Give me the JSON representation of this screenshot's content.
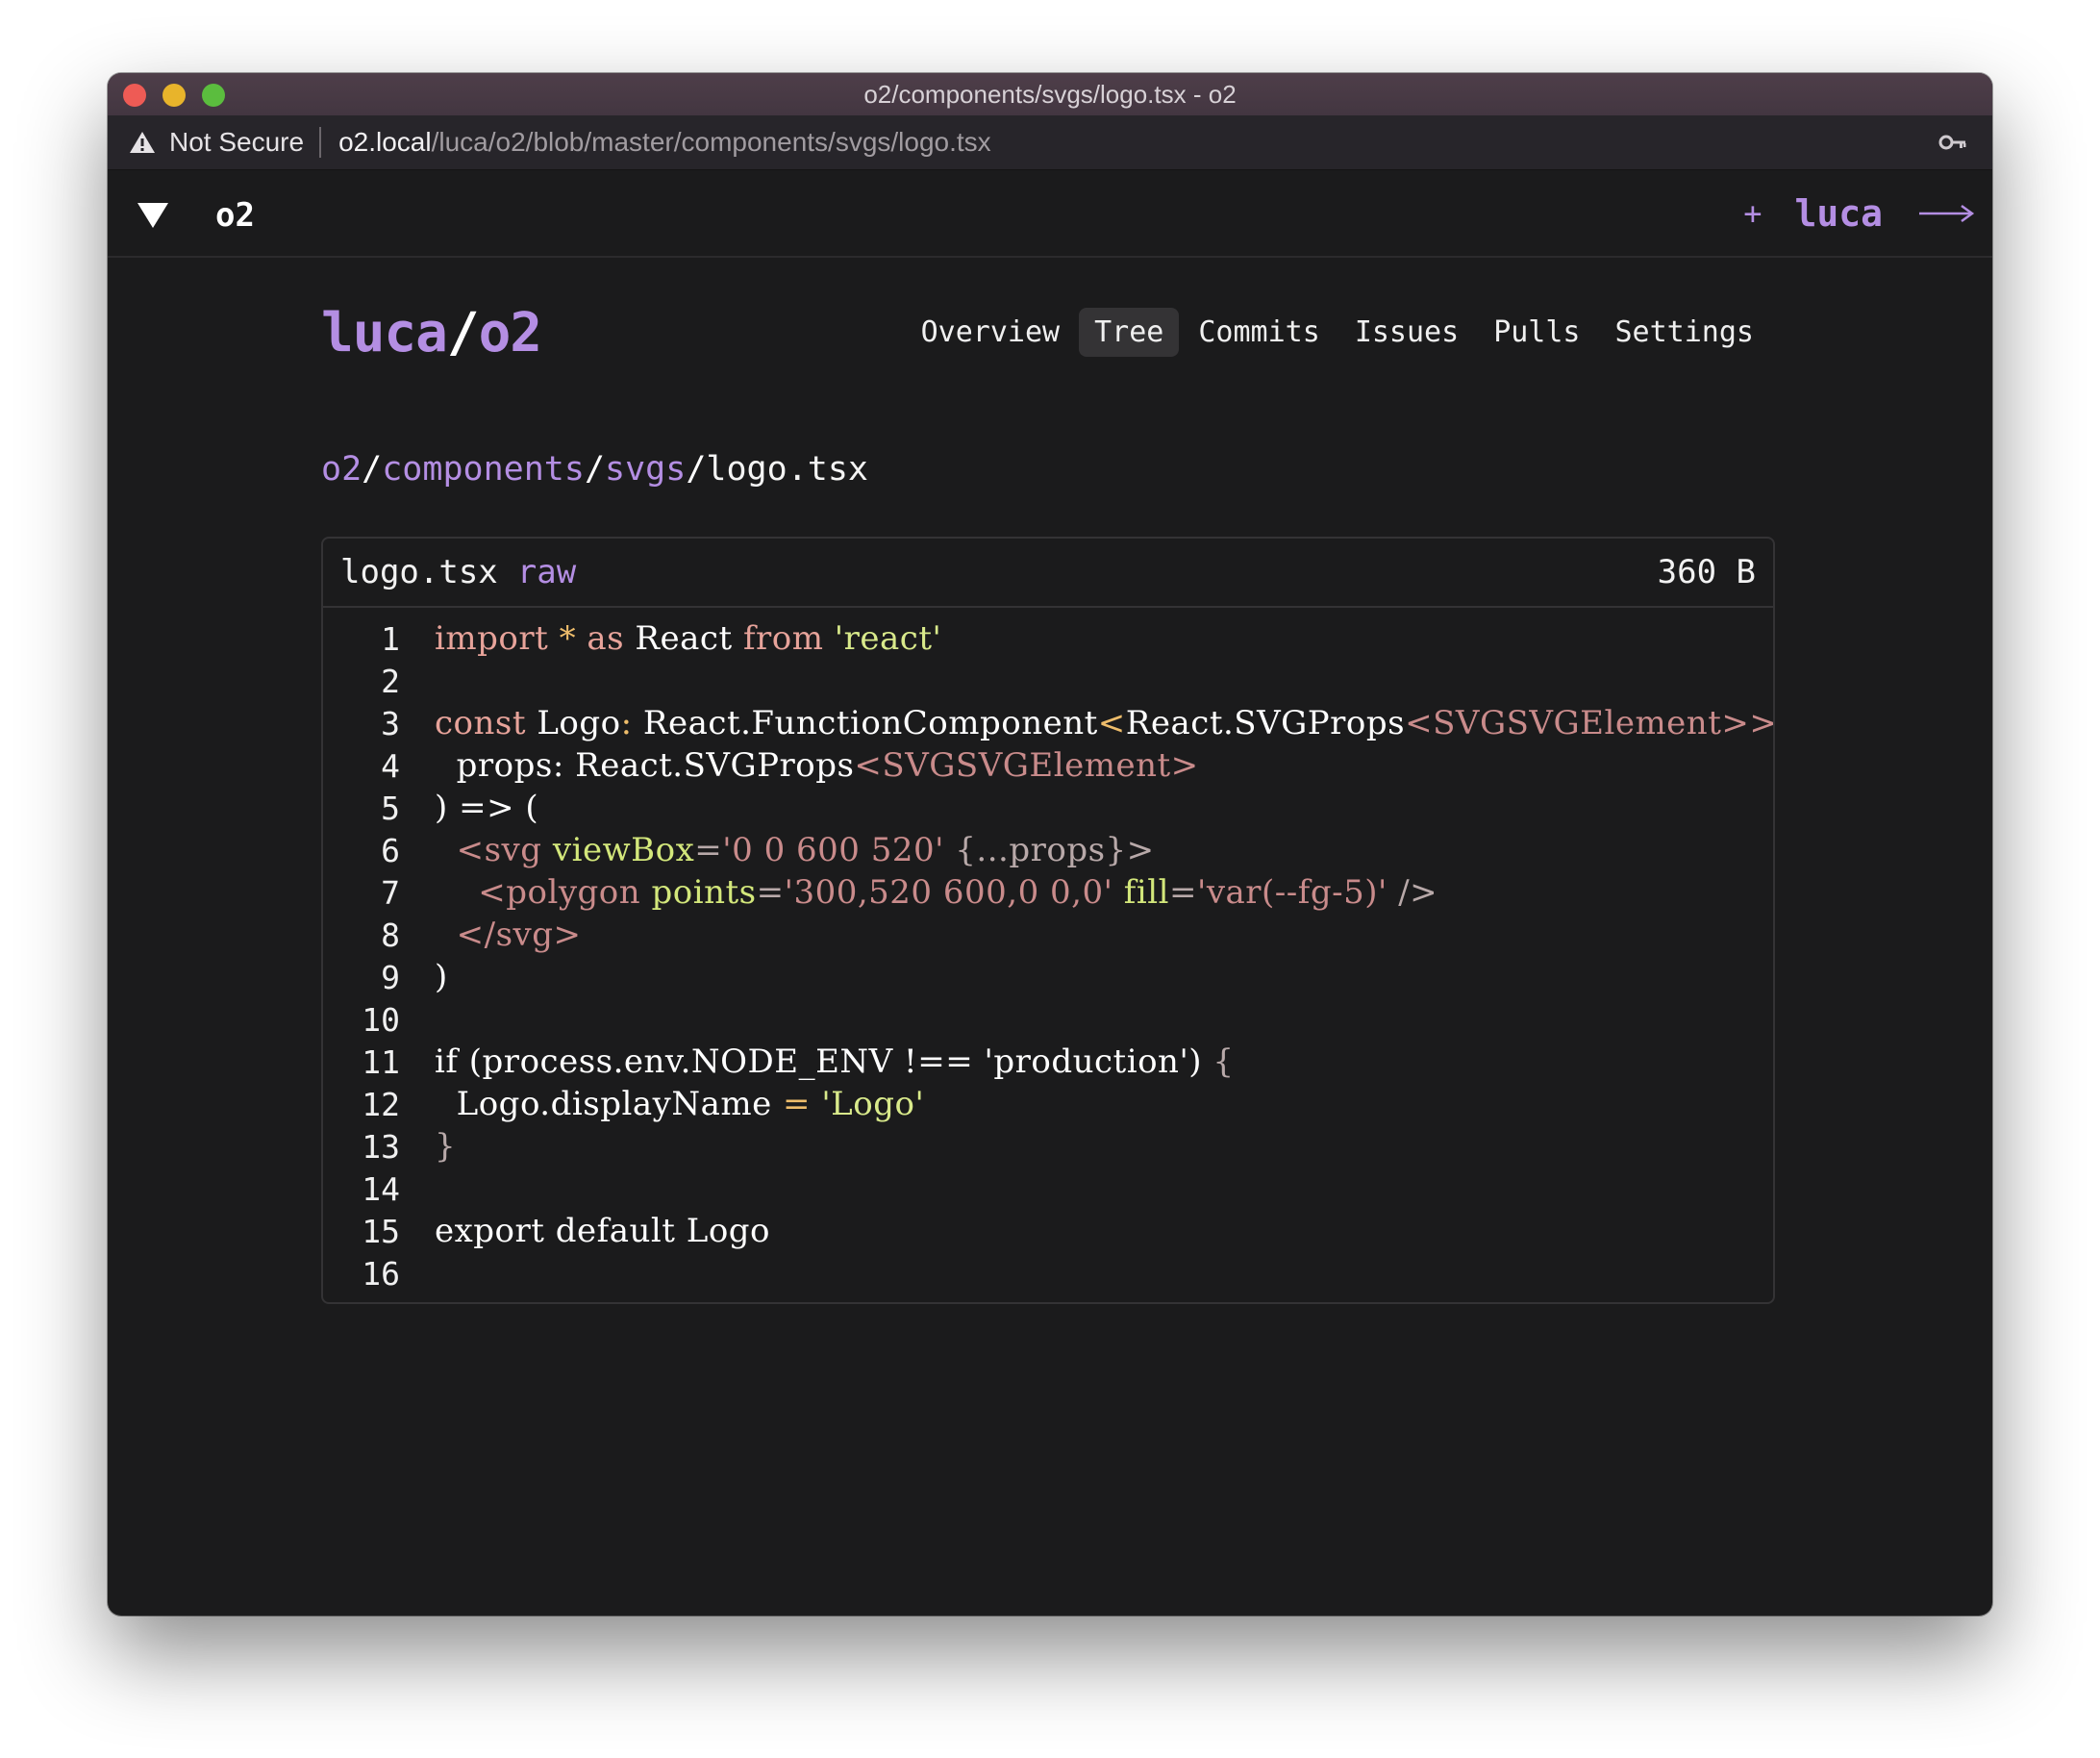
{
  "window": {
    "title": "o2/components/svgs/logo.tsx - o2"
  },
  "address": {
    "security_label": "Not Secure",
    "host": "o2.local",
    "path": "/luca/o2/blob/master/components/svgs/logo.tsx"
  },
  "header": {
    "brand": "o2",
    "plus": "+",
    "user": "luca"
  },
  "repo": {
    "owner": "luca",
    "slash": "/",
    "name": "o2"
  },
  "nav": {
    "tabs": [
      {
        "label": "Overview",
        "active": false
      },
      {
        "label": "Tree",
        "active": true
      },
      {
        "label": "Commits",
        "active": false
      },
      {
        "label": "Issues",
        "active": false
      },
      {
        "label": "Pulls",
        "active": false
      },
      {
        "label": "Settings",
        "active": false
      }
    ]
  },
  "breadcrumb": {
    "parts": [
      "o2",
      "components",
      "svgs"
    ],
    "current": "logo.tsx",
    "sep": "/"
  },
  "file": {
    "name": "logo.tsx",
    "raw_label": "raw",
    "size": "360 B"
  },
  "code": {
    "lines": [
      [
        [
          "kw",
          "import"
        ],
        [
          "txt",
          " "
        ],
        [
          "op",
          "*"
        ],
        [
          "txt",
          " "
        ],
        [
          "kw",
          "as"
        ],
        [
          "txt",
          " "
        ],
        [
          "ident",
          "React"
        ],
        [
          "txt",
          " "
        ],
        [
          "kw",
          "from"
        ],
        [
          "txt",
          " "
        ],
        [
          "str",
          "'react'"
        ]
      ],
      [],
      [
        [
          "kw",
          "const"
        ],
        [
          "txt",
          " "
        ],
        [
          "ident",
          "Logo"
        ],
        [
          "op",
          ":"
        ],
        [
          "txt",
          " "
        ],
        [
          "ident",
          "React.FunctionComponent"
        ],
        [
          "op",
          "<"
        ],
        [
          "ident",
          "React.SVGProps"
        ],
        [
          "tag",
          "<SVGSVGElement>>"
        ],
        [
          "txt",
          " "
        ],
        [
          "op",
          "="
        ],
        [
          "txt",
          " ("
        ]
      ],
      [
        [
          "txt",
          "  "
        ],
        [
          "ident",
          "props:"
        ],
        [
          "txt",
          " "
        ],
        [
          "ident",
          "React.SVGProps"
        ],
        [
          "tag",
          "<SVGSVGElement>"
        ]
      ],
      [
        [
          "ident",
          ")"
        ],
        [
          "txt",
          " "
        ],
        [
          "ident",
          "=>"
        ],
        [
          "txt",
          " "
        ],
        [
          "ident",
          "("
        ]
      ],
      [
        [
          "txt",
          "  "
        ],
        [
          "tag",
          "<svg"
        ],
        [
          "txt",
          " "
        ],
        [
          "attr",
          "viewBox"
        ],
        [
          "punc",
          "="
        ],
        [
          "tag",
          "'0 0 600 520'"
        ],
        [
          "txt",
          " "
        ],
        [
          "punc",
          "{...props}>"
        ]
      ],
      [
        [
          "txt",
          "    "
        ],
        [
          "tag",
          "<polygon"
        ],
        [
          "txt",
          " "
        ],
        [
          "attr",
          "points"
        ],
        [
          "punc",
          "="
        ],
        [
          "tag",
          "'300,520 600,0 0,0'"
        ],
        [
          "txt",
          " "
        ],
        [
          "attr",
          "fill"
        ],
        [
          "punc",
          "="
        ],
        [
          "tag",
          "'var(--fg-5)'"
        ],
        [
          "txt",
          " "
        ],
        [
          "punc",
          "/>"
        ]
      ],
      [
        [
          "txt",
          "  "
        ],
        [
          "tag",
          "</svg>"
        ]
      ],
      [
        [
          "ident",
          ")"
        ]
      ],
      [],
      [
        [
          "ident",
          "if"
        ],
        [
          "txt",
          " "
        ],
        [
          "ident",
          "(process.env.NODE_ENV"
        ],
        [
          "txt",
          " "
        ],
        [
          "ident",
          "!=="
        ],
        [
          "txt",
          " "
        ],
        [
          "ident",
          "'production')"
        ],
        [
          "txt",
          " "
        ],
        [
          "punc",
          "{"
        ]
      ],
      [
        [
          "txt",
          "  "
        ],
        [
          "ident",
          "Logo.displayName"
        ],
        [
          "txt",
          " "
        ],
        [
          "op",
          "="
        ],
        [
          "txt",
          " "
        ],
        [
          "str",
          "'Logo'"
        ]
      ],
      [
        [
          "punc",
          "}"
        ]
      ],
      [],
      [
        [
          "ident",
          "export default Logo"
        ]
      ],
      []
    ]
  },
  "colors": {
    "accent": "#b48ee3",
    "background": "#1b1b1c",
    "titlebar": "#4e3e49"
  }
}
